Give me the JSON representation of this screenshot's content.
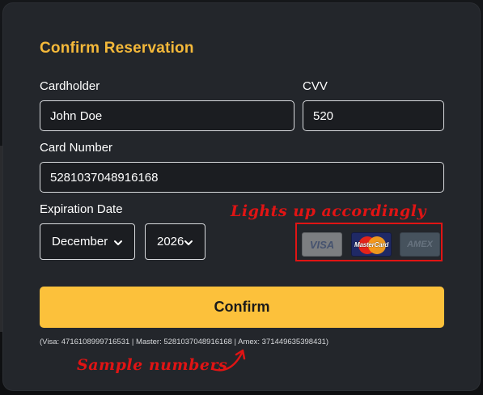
{
  "modal": {
    "title": "Confirm Reservation"
  },
  "form": {
    "cardholder_label": "Cardholder",
    "cardholder_value": "John Doe",
    "cvv_label": "CVV",
    "cvv_value": "520",
    "card_number_label": "Card Number",
    "card_number_value": "5281037048916168",
    "expiration_label": "Expiration Date",
    "month_selected": "December",
    "year_selected": "2026"
  },
  "card_brands": {
    "visa": "VISA",
    "mastercard": "MasterCard",
    "amex": "AMEX",
    "active": "mastercard"
  },
  "annotations": {
    "cards_note": "Lights up accordingly",
    "samples_note": "Sample numbers"
  },
  "actions": {
    "confirm_label": "Confirm"
  },
  "footer": {
    "sample_text": "(Visa: 4716108999716531 | Master: 5281037048916168 | Amex: 371449635398431)"
  },
  "colors": {
    "accent": "#fcc13b",
    "title": "#f5b93a",
    "annotation": "#e01414",
    "modal_bg": "#23262b"
  }
}
